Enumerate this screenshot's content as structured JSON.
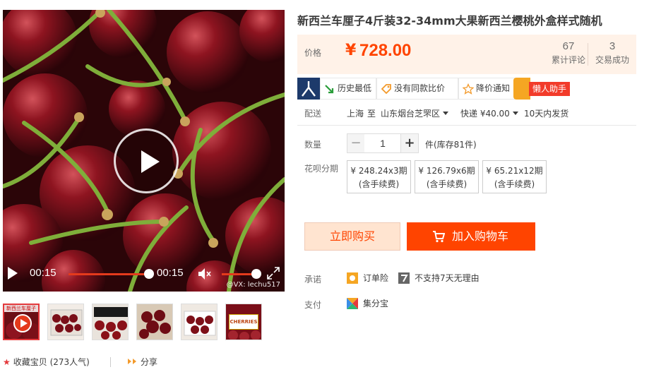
{
  "product": {
    "title": "新西兰车厘子4斤装32-34mm大果新西兰樱桃外盒样式随机"
  },
  "video": {
    "time_current": "00:15",
    "time_total": "00:15",
    "watermark": "@VX: lechu517",
    "progress": 1.0,
    "volume": 0.9
  },
  "thumbs": [
    {
      "name": "video-thumb",
      "label": "新西兰车厘子"
    },
    {
      "name": "cherries-box",
      "label": ""
    },
    {
      "name": "cherries-box-open",
      "label": ""
    },
    {
      "name": "cherries-bowl",
      "label": ""
    },
    {
      "name": "cherries-box-2",
      "label": ""
    },
    {
      "name": "cherries-sign",
      "label": "CHERRIES"
    }
  ],
  "actions": {
    "collect": "收藏宝贝 (273人气)",
    "share": "分享"
  },
  "price": {
    "label": "价格",
    "currency": "¥",
    "value": "728.00",
    "reviews_count": "67",
    "reviews_label": "累计评论",
    "deals_count": "3",
    "deals_label": "交易成功"
  },
  "tools": {
    "history_low": "历史最低",
    "compare": "没有同款比价",
    "price_alert": "降价通知",
    "helper": "懒人助手"
  },
  "delivery": {
    "label": "配送",
    "from": "上海",
    "to_word": "至",
    "destination": "山东烟台芝罘区",
    "shipping": "快递 ¥40.00",
    "ship_time": "10天内发货"
  },
  "quantity": {
    "label": "数量",
    "minus": "−",
    "plus": "+",
    "value": "1",
    "stock": "件(库存81件)"
  },
  "installments": {
    "label": "花呗分期",
    "options": [
      {
        "amount": "¥ 248.24x3期",
        "fee": "(含手续费)"
      },
      {
        "amount": "¥ 126.79x6期",
        "fee": "(含手续费)"
      },
      {
        "amount": "¥ 65.21x12期",
        "fee": "(含手续费)"
      }
    ]
  },
  "buttons": {
    "buy_now": "立即购买",
    "add_cart": "加入购物车"
  },
  "promise": {
    "label": "承诺",
    "item1": "订单险",
    "item2": "不支持7天无理由"
  },
  "payment": {
    "label": "支付",
    "method": "集分宝"
  },
  "colors": {
    "accent": "#ff4400",
    "price_bg": "#fff2e8"
  }
}
